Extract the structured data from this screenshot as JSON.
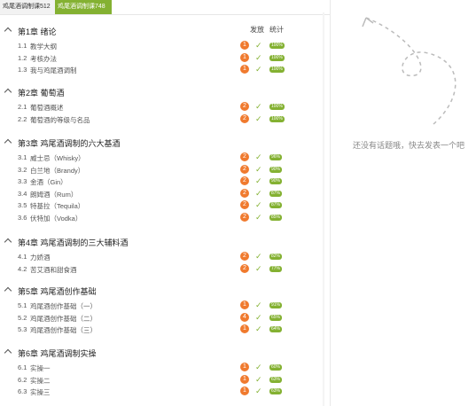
{
  "tabs": {
    "tab1": "鸡尾酒调制课512",
    "tab2": "鸡尾酒调制课748"
  },
  "columns": {
    "reply": "发放",
    "stats": "统计"
  },
  "chapters": [
    {
      "title": "第1章  绪论",
      "lessons": [
        {
          "num": "1.1",
          "title": "教学大纲",
          "badge": "1",
          "pct": "100%"
        },
        {
          "num": "1.2",
          "title": "考核办法",
          "badge": "1",
          "pct": "100%"
        },
        {
          "num": "1.3",
          "title": "我与鸡尾酒调制",
          "badge": "1",
          "pct": "100%"
        }
      ]
    },
    {
      "title": "第2章  葡萄酒",
      "lessons": [
        {
          "num": "2.1",
          "title": "葡萄酒概述",
          "badge": "2",
          "pct": "100%"
        },
        {
          "num": "2.2",
          "title": "葡萄酒的等级与名品",
          "badge": "2",
          "pct": "100%"
        }
      ]
    },
    {
      "title": "第3章  鸡尾酒调制的六大基酒",
      "lessons": [
        {
          "num": "3.1",
          "title": "威士忌（Whisky）",
          "badge": "2",
          "pct": "96%"
        },
        {
          "num": "3.2",
          "title": "白兰地（Brandy）",
          "badge": "2",
          "pct": "90%"
        },
        {
          "num": "3.3",
          "title": "金酒（Gin）",
          "badge": "2",
          "pct": "90%"
        },
        {
          "num": "3.4",
          "title": "朗姆酒（Rum）",
          "badge": "2",
          "pct": "87%"
        },
        {
          "num": "3.5",
          "title": "特基拉（Tequila）",
          "badge": "2",
          "pct": "87%"
        },
        {
          "num": "3.6",
          "title": "伏特加（Vodka）",
          "badge": "2",
          "pct": "85%"
        }
      ]
    },
    {
      "title": "第4章  鸡尾酒调制的三大辅料酒",
      "lessons": [
        {
          "num": "4.1",
          "title": "力娇酒",
          "badge": "2",
          "pct": "82%"
        },
        {
          "num": "4.2",
          "title": "苦艾酒和甜食酒",
          "badge": "2",
          "pct": "77%"
        }
      ]
    },
    {
      "title": "第5章  鸡尾酒创作基础",
      "lessons": [
        {
          "num": "5.1",
          "title": "鸡尾酒创作基础（一）",
          "badge": "1",
          "pct": "91%"
        },
        {
          "num": "5.2",
          "title": "鸡尾酒创作基础（二）",
          "badge": "4",
          "pct": "65%"
        },
        {
          "num": "5.3",
          "title": "鸡尾酒创作基础（三）",
          "badge": "1",
          "pct": "64%"
        }
      ]
    },
    {
      "title": "第6章  鸡尾酒调制实操",
      "lessons": [
        {
          "num": "6.1",
          "title": "实操一",
          "badge": "1",
          "pct": "60%"
        },
        {
          "num": "6.2",
          "title": "实操二",
          "badge": "1",
          "pct": "63%"
        },
        {
          "num": "6.3",
          "title": "实操三",
          "badge": "1",
          "pct": "63%"
        }
      ]
    }
  ],
  "empty_message": "还没有话题哦，快去发表一个吧",
  "colors": {
    "accent": "#84b132",
    "badge": "#f07a2e"
  },
  "icons": {
    "check": "check-icon",
    "caret": "caret-up-icon",
    "arrow": "dashed-arrow-icon"
  }
}
